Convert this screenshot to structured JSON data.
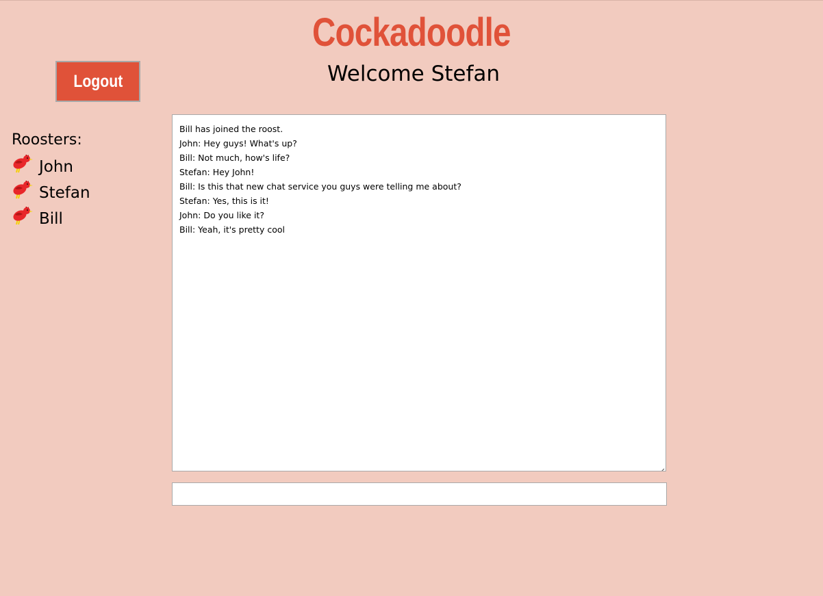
{
  "header": {
    "app_title": "Cockadoodle",
    "welcome": "Welcome Stefan"
  },
  "toolbar": {
    "logout_label": "Logout"
  },
  "sidebar": {
    "heading": "Roosters:",
    "items": [
      {
        "label": "John",
        "icon": "rooster-icon"
      },
      {
        "label": "Stefan",
        "icon": "rooster-icon"
      },
      {
        "label": "Bill",
        "icon": "rooster-icon"
      }
    ]
  },
  "chat": {
    "messages": [
      "Bill has joined the roost.",
      "John: Hey guys! What's up?",
      "Bill: Not much, how's life?",
      "Stefan: Hey John!",
      "Bill: Is this that new chat service you guys were telling me about?",
      "Stefan: Yes, this is it!",
      "John: Do you like it?",
      "Bill: Yeah, it's pretty cool"
    ],
    "input_value": "",
    "input_placeholder": ""
  },
  "colors": {
    "background": "#f2cbbf",
    "accent": "#e05239",
    "rooster_body": "#e8262a",
    "rooster_legs": "#f5d000"
  }
}
